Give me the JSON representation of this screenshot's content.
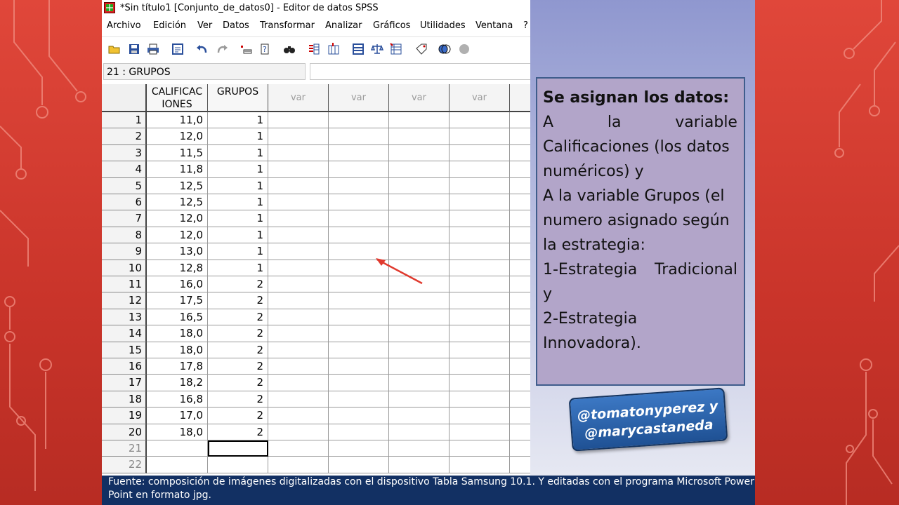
{
  "window": {
    "title": "*Sin título1 [Conjunto_de_datos0] - Editor de datos SPSS"
  },
  "menu": [
    "Archivo",
    "Edición",
    "Ver",
    "Datos",
    "Transformar",
    "Analizar",
    "Gráficos",
    "Utilidades",
    "Ventana",
    "?"
  ],
  "toolbar_icons": [
    "open-icon",
    "save-icon",
    "print-icon",
    "dialog-recall-icon",
    "undo-icon",
    "redo-icon",
    "goto-case-icon",
    "variables-icon",
    "find-icon",
    "insert-cases-icon",
    "insert-variable-icon",
    "split-file-icon",
    "weight-cases-icon",
    "select-cases-icon",
    "value-labels-icon",
    "use-sets-icon",
    "show-all-icon"
  ],
  "cell_reference": "21 : GRUPOS",
  "cell_value": "",
  "grid": {
    "columns": [
      "CALIFICAC IONES",
      "GRUPOS",
      "var",
      "var",
      "var",
      "var"
    ],
    "rows": [
      {
        "n": "1",
        "cal": "11,0",
        "grp": "1"
      },
      {
        "n": "2",
        "cal": "12,0",
        "grp": "1"
      },
      {
        "n": "3",
        "cal": "11,5",
        "grp": "1"
      },
      {
        "n": "4",
        "cal": "11,8",
        "grp": "1"
      },
      {
        "n": "5",
        "cal": "12,5",
        "grp": "1"
      },
      {
        "n": "6",
        "cal": "12,5",
        "grp": "1"
      },
      {
        "n": "7",
        "cal": "12,0",
        "grp": "1"
      },
      {
        "n": "8",
        "cal": "12,0",
        "grp": "1"
      },
      {
        "n": "9",
        "cal": "13,0",
        "grp": "1"
      },
      {
        "n": "10",
        "cal": "12,8",
        "grp": "1"
      },
      {
        "n": "11",
        "cal": "16,0",
        "grp": "2"
      },
      {
        "n": "12",
        "cal": "17,5",
        "grp": "2"
      },
      {
        "n": "13",
        "cal": "16,5",
        "grp": "2"
      },
      {
        "n": "14",
        "cal": "18,0",
        "grp": "2"
      },
      {
        "n": "15",
        "cal": "18,0",
        "grp": "2"
      },
      {
        "n": "16",
        "cal": "17,8",
        "grp": "2"
      },
      {
        "n": "17",
        "cal": "18,2",
        "grp": "2"
      },
      {
        "n": "18",
        "cal": "16,8",
        "grp": "2"
      },
      {
        "n": "19",
        "cal": "17,0",
        "grp": "2"
      },
      {
        "n": "20",
        "cal": "18,0",
        "grp": "2"
      },
      {
        "n": "21",
        "cal": "",
        "grp": ""
      },
      {
        "n": "22",
        "cal": "",
        "grp": ""
      }
    ],
    "selected_row": "21",
    "selected_column": "GRUPOS"
  },
  "info_box": {
    "heading": "Se  asignan los datos:",
    "line1_words": [
      "A",
      "la",
      "variable"
    ],
    "line2": "Calificaciones (los datos",
    "line3": "numéricos) y",
    "line4": "A la variable Grupos (el",
    "line5": "numero asignado según",
    "line6": "la estrategia:",
    "line7_words": [
      "1-Estrategia",
      "Tradicional"
    ],
    "line8": "y",
    "line9": "2-Estrategia",
    "line10": "Innovadora)."
  },
  "handle_badge": {
    "line1": "@tomatonyperez y",
    "line2": "@marycastaneda"
  },
  "footer": {
    "text": "Fuente: composición de imágenes digitalizadas con el  dispositivo Tabla Samsung 10.1. Y editadas con el programa Microsoft Power Point en formato jpg."
  },
  "colors": {
    "background_red": "#c93a2d",
    "middle_blue": "#8f97cf",
    "info_box_fill": "#b2a5c9",
    "footer_navy": "#123063",
    "badge_blue": "#2b63ad",
    "arrow_red": "#e03a2e"
  }
}
